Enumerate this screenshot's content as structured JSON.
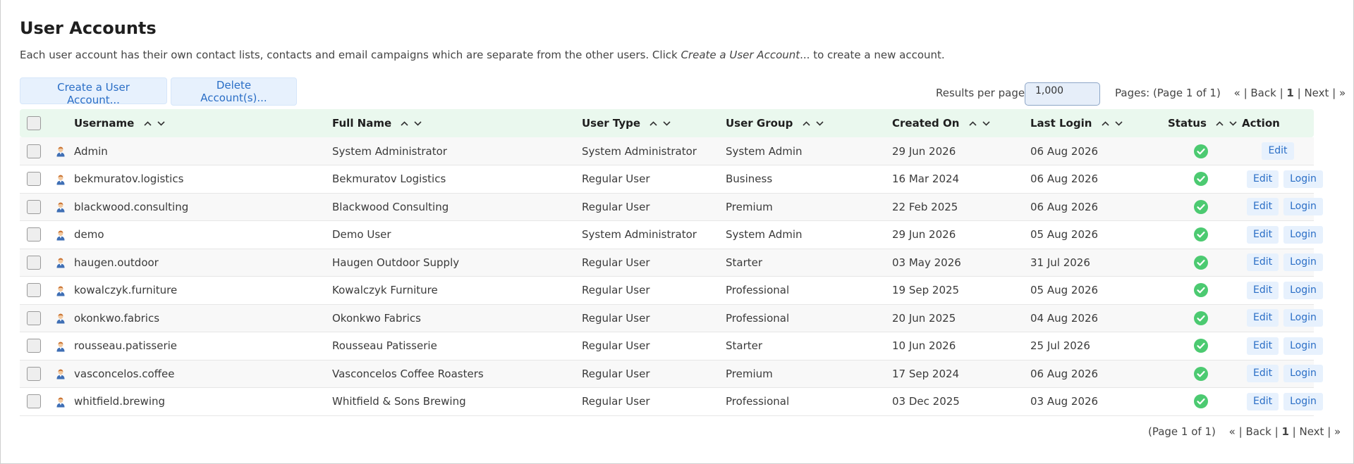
{
  "page": {
    "title": "User Accounts",
    "intro_prefix": "Each user account has their own contact lists, contacts and email campaigns which are separate from the other users. Click ",
    "intro_link": "Create a User Account",
    "intro_suffix": "... to create a new account."
  },
  "toolbar": {
    "create_label": "Create a User Account...",
    "delete_label": "Delete Account(s)...",
    "results_per_page_label": "Results per page:",
    "results_per_page_value": "1,000"
  },
  "pager_top": {
    "pages_label": "Pages: (Page 1 of 1)",
    "first": "«",
    "back": "Back",
    "current": "1",
    "next": "Next",
    "last": "»"
  },
  "pager_bottom": {
    "pages_label": "(Page 1 of 1)",
    "first": "«",
    "back": "Back",
    "current": "1",
    "next": "Next",
    "last": "»"
  },
  "table": {
    "columns": {
      "username": "Username",
      "full_name": "Full Name",
      "user_type": "User Type",
      "user_group": "User Group",
      "created_on": "Created On",
      "last_login": "Last Login",
      "status": "Status",
      "action": "Action"
    },
    "action_labels": {
      "edit": "Edit",
      "login": "Login"
    },
    "status_color": "#4cca71",
    "rows": [
      {
        "username": "Admin",
        "full_name": "System Administrator",
        "user_type": "System Administrator",
        "user_group": "System Admin",
        "created_on": "29 Jun 2026",
        "last_login": "06 Aug 2026",
        "can_login": false
      },
      {
        "username": "bekmuratov.logistics",
        "full_name": "Bekmuratov Logistics",
        "user_type": "Regular User",
        "user_group": "Business",
        "created_on": "16 Mar 2024",
        "last_login": "06 Aug 2026",
        "can_login": true
      },
      {
        "username": "blackwood.consulting",
        "full_name": "Blackwood Consulting",
        "user_type": "Regular User",
        "user_group": "Premium",
        "created_on": "22 Feb 2025",
        "last_login": "06 Aug 2026",
        "can_login": true
      },
      {
        "username": "demo",
        "full_name": "Demo User",
        "user_type": "System Administrator",
        "user_group": "System Admin",
        "created_on": "29 Jun 2026",
        "last_login": "05 Aug 2026",
        "can_login": true
      },
      {
        "username": "haugen.outdoor",
        "full_name": "Haugen Outdoor Supply",
        "user_type": "Regular User",
        "user_group": "Starter",
        "created_on": "03 May 2026",
        "last_login": "31 Jul 2026",
        "can_login": true
      },
      {
        "username": "kowalczyk.furniture",
        "full_name": "Kowalczyk Furniture",
        "user_type": "Regular User",
        "user_group": "Professional",
        "created_on": "19 Sep 2025",
        "last_login": "05 Aug 2026",
        "can_login": true
      },
      {
        "username": "okonkwo.fabrics",
        "full_name": "Okonkwo Fabrics",
        "user_type": "Regular User",
        "user_group": "Professional",
        "created_on": "20 Jun 2025",
        "last_login": "04 Aug 2026",
        "can_login": true
      },
      {
        "username": "rousseau.patisserie",
        "full_name": "Rousseau Patisserie",
        "user_type": "Regular User",
        "user_group": "Starter",
        "created_on": "10 Jun 2026",
        "last_login": "25 Jul 2026",
        "can_login": true
      },
      {
        "username": "vasconcelos.coffee",
        "full_name": "Vasconcelos Coffee Roasters",
        "user_type": "Regular User",
        "user_group": "Premium",
        "created_on": "17 Sep 2024",
        "last_login": "06 Aug 2026",
        "can_login": true
      },
      {
        "username": "whitfield.brewing",
        "full_name": "Whitfield & Sons Brewing",
        "user_type": "Regular User",
        "user_group": "Professional",
        "created_on": "03 Dec 2025",
        "last_login": "03 Aug 2026",
        "can_login": true
      }
    ]
  }
}
